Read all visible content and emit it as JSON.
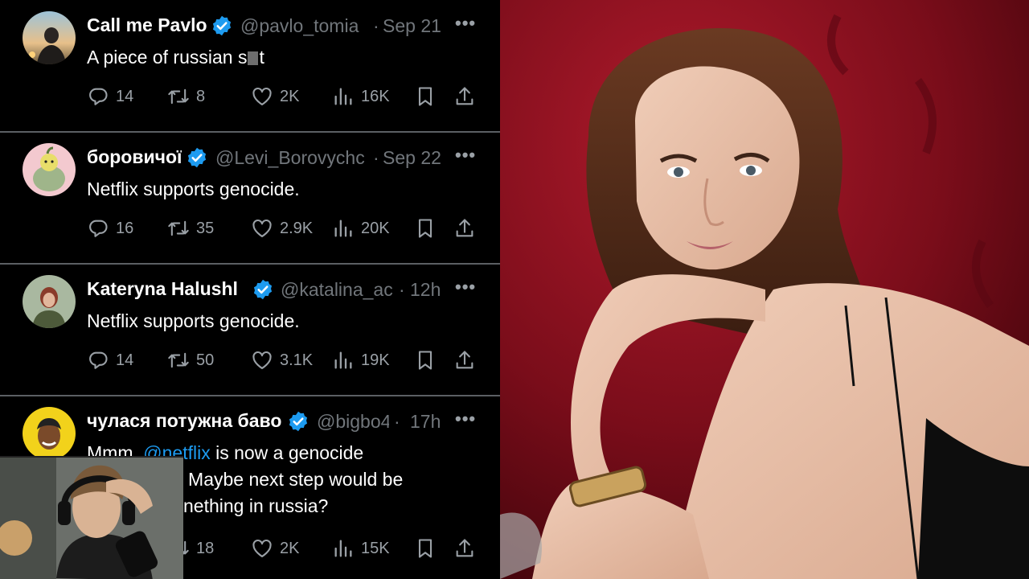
{
  "tweets": [
    {
      "name": "Call me Pavlο",
      "handle": "@pavlo_tomia",
      "dot": "·",
      "time": "Sep 21",
      "text_before": "A piece of russian s",
      "text_after": "t",
      "stats": {
        "replies": "14",
        "reposts": "8",
        "likes": "2K",
        "views": "16K"
      }
    },
    {
      "name": "боровичої",
      "handle": "@Levi_Borovychc",
      "dot": "·",
      "time": "Sep 22",
      "text": "Netflix supports genocide.",
      "stats": {
        "replies": "16",
        "reposts": "35",
        "likes": "2.9K",
        "views": "20K"
      }
    },
    {
      "name": "Kateryna Halushl",
      "handle": "@katalina_ac",
      "dot": "·",
      "time": "12h",
      "text": "Netflix supports genocide.",
      "stats": {
        "replies": "14",
        "reposts": "50",
        "likes": "3.1K",
        "views": "19K"
      }
    },
    {
      "name": "чулася потужна баво",
      "handle": "@bigbo4",
      "dot": "·",
      "time": "17h",
      "text_line1_a": "Mmm, ",
      "mention": "@netflix",
      "text_line1_b": " is now a genocide",
      "text_line2": ") Maybe next step would be",
      "text_line3": "nething in russia?",
      "stats": {
        "reposts": "18",
        "likes": "2K",
        "views": "15K"
      }
    }
  ],
  "more_label": "•••",
  "icons": {
    "reply": "reply-icon",
    "repost": "repost-icon",
    "like": "like-icon",
    "views": "views-icon",
    "bookmark": "bookmark-icon",
    "share": "share-icon",
    "verified": "verified-badge-icon"
  },
  "colors": {
    "background": "#000000",
    "handle": "#71767b",
    "mention": "#1d9bf0",
    "verified": "#1d9bf0",
    "divider": "#5b5f63",
    "photo_backdrop": "#7a0d1a"
  }
}
